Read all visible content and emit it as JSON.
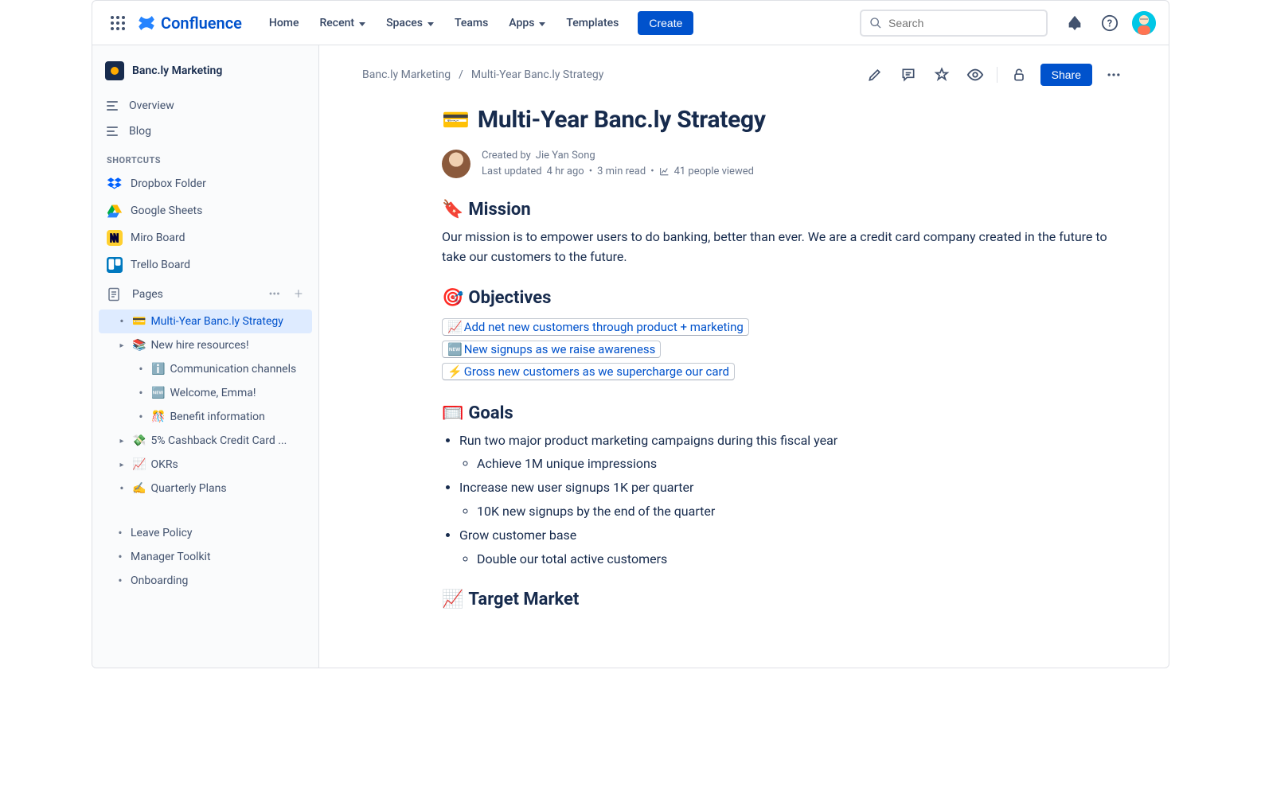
{
  "brand": "Confluence",
  "nav": {
    "home": "Home",
    "recent": "Recent",
    "spaces": "Spaces",
    "teams": "Teams",
    "apps": "Apps",
    "templates": "Templates",
    "create": "Create"
  },
  "search": {
    "placeholder": "Search"
  },
  "space": {
    "name": "Banc.ly Marketing",
    "overview": "Overview",
    "blog": "Blog"
  },
  "shortcuts": {
    "label": "SHORTCUTS",
    "items": [
      {
        "label": "Dropbox Folder"
      },
      {
        "label": "Google Sheets"
      },
      {
        "label": "Miro Board"
      },
      {
        "label": "Trello Board"
      }
    ]
  },
  "pages": {
    "label": "Pages",
    "tree": [
      {
        "icon": "💳",
        "label": "Multi-Year Banc.ly Strategy",
        "active": true,
        "indent": 1,
        "expander": "dot"
      },
      {
        "icon": "📚",
        "label": "New hire resources!",
        "indent": 1,
        "expander": "chev"
      },
      {
        "icon": "ℹ️",
        "label": "Communication channels",
        "indent": 2,
        "expander": "dot"
      },
      {
        "icon": "🆕",
        "label": "Welcome, Emma!",
        "indent": 2,
        "expander": "dot"
      },
      {
        "icon": "🎊",
        "label": "Benefit information",
        "indent": 2,
        "expander": "dot"
      },
      {
        "icon": "💸",
        "label": "5% Cashback Credit Card ...",
        "indent": 1,
        "expander": "chev"
      },
      {
        "icon": "📈",
        "label": "OKRs",
        "indent": 1,
        "expander": "chev"
      },
      {
        "icon": "✍️",
        "label": "Quarterly Plans",
        "indent": 1,
        "expander": "dot"
      }
    ],
    "footer": [
      {
        "label": "Leave Policy"
      },
      {
        "label": "Manager Toolkit"
      },
      {
        "label": "Onboarding"
      }
    ]
  },
  "breadcrumb": {
    "space": "Banc.ly Marketing",
    "page": "Multi-Year Banc.ly Strategy"
  },
  "actions": {
    "share": "Share"
  },
  "page": {
    "emoji": "💳",
    "title": "Multi-Year Banc.ly Strategy",
    "created_by_label": "Created by",
    "author": "Jie Yan Song",
    "updated_label": "Last updated",
    "updated_value": "4 hr ago",
    "read_time": "3 min read",
    "views": "41 people viewed"
  },
  "sections": {
    "mission": {
      "emoji": "🔖",
      "title": "Mission",
      "body": "Our mission is to empower users to do banking, better than ever. We are a credit card company created in the future to take our customers to the future."
    },
    "objectives": {
      "emoji": "🎯",
      "title": "Objectives",
      "links": [
        {
          "icon": "📈",
          "text": "Add net new customers through product + marketing"
        },
        {
          "icon": "🆕",
          "text": "New signups as we raise awareness"
        },
        {
          "icon": "⚡",
          "text": "Gross new customers as we supercharge our card"
        }
      ]
    },
    "goals": {
      "emoji": "🥅",
      "title": "Goals",
      "items": [
        {
          "text": "Run two major product marketing campaigns during this fiscal year",
          "sub": "Achieve 1M unique impressions"
        },
        {
          "text": "Increase new user signups 1K per quarter",
          "sub": "10K new signups by the end of the quarter"
        },
        {
          "text": "Grow customer base",
          "sub": "Double our total active customers"
        }
      ]
    },
    "target_market": {
      "emoji": "📈",
      "title": "Target Market"
    }
  }
}
